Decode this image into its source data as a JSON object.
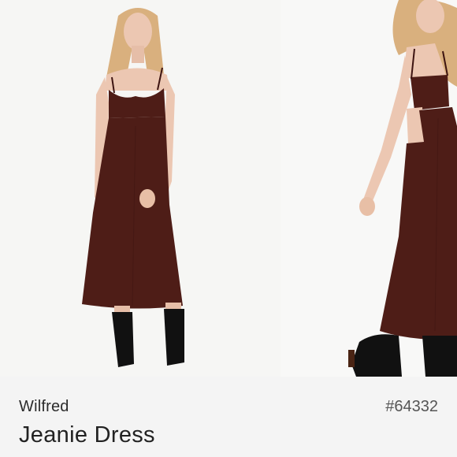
{
  "listing": {
    "brand": "Wilfred",
    "id": "#64332",
    "title": "Jeanie Dress"
  },
  "photos": [
    {
      "name": "model-front-photo"
    },
    {
      "name": "model-side-photo"
    }
  ],
  "colors": {
    "dress": "#4e1d17",
    "dress_shade": "#3d1411",
    "skin": "#ecc7b2",
    "hair": "#d9b07e",
    "boots": "#111111",
    "info_bar": "#f4f4f4"
  }
}
